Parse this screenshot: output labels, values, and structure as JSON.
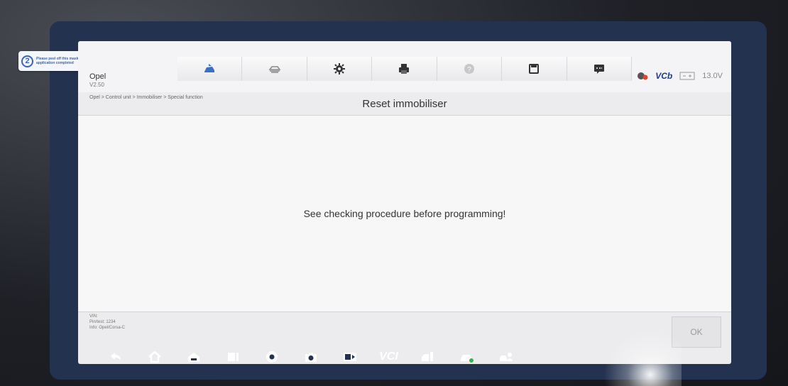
{
  "sticker": {
    "number": "2",
    "text": "Please peel off this mask AFTER application completed"
  },
  "header": {
    "make": "Opel",
    "version": "V2.50",
    "vci": "VCb",
    "voltage": "13.0V"
  },
  "toolbar": {
    "icons": [
      "car-home-icon",
      "vehicle-menu-icon",
      "settings-icon",
      "print-icon",
      "help-icon",
      "save-icon",
      "data-logging-icon"
    ]
  },
  "breadcrumb": "Opel > Control unit > Immobiliser > Special function",
  "page_title": "Reset immobiliser",
  "main_message": "See checking procedure before programming!",
  "info": {
    "vin": "VIN:",
    "pin": "Pin/test: 1234",
    "model": "Info: Opel/Corsa-C"
  },
  "ok_button": "OK",
  "navbar": {
    "vci_label": "VCI",
    "icons": [
      "back-icon",
      "home-icon",
      "car-home-icon",
      "apps-icon",
      "chrome-icon",
      "camera-icon",
      "screen-record-icon",
      "vci-icon",
      "battery-test-icon",
      "vehicle-diag-icon",
      "remote-support-icon"
    ]
  }
}
